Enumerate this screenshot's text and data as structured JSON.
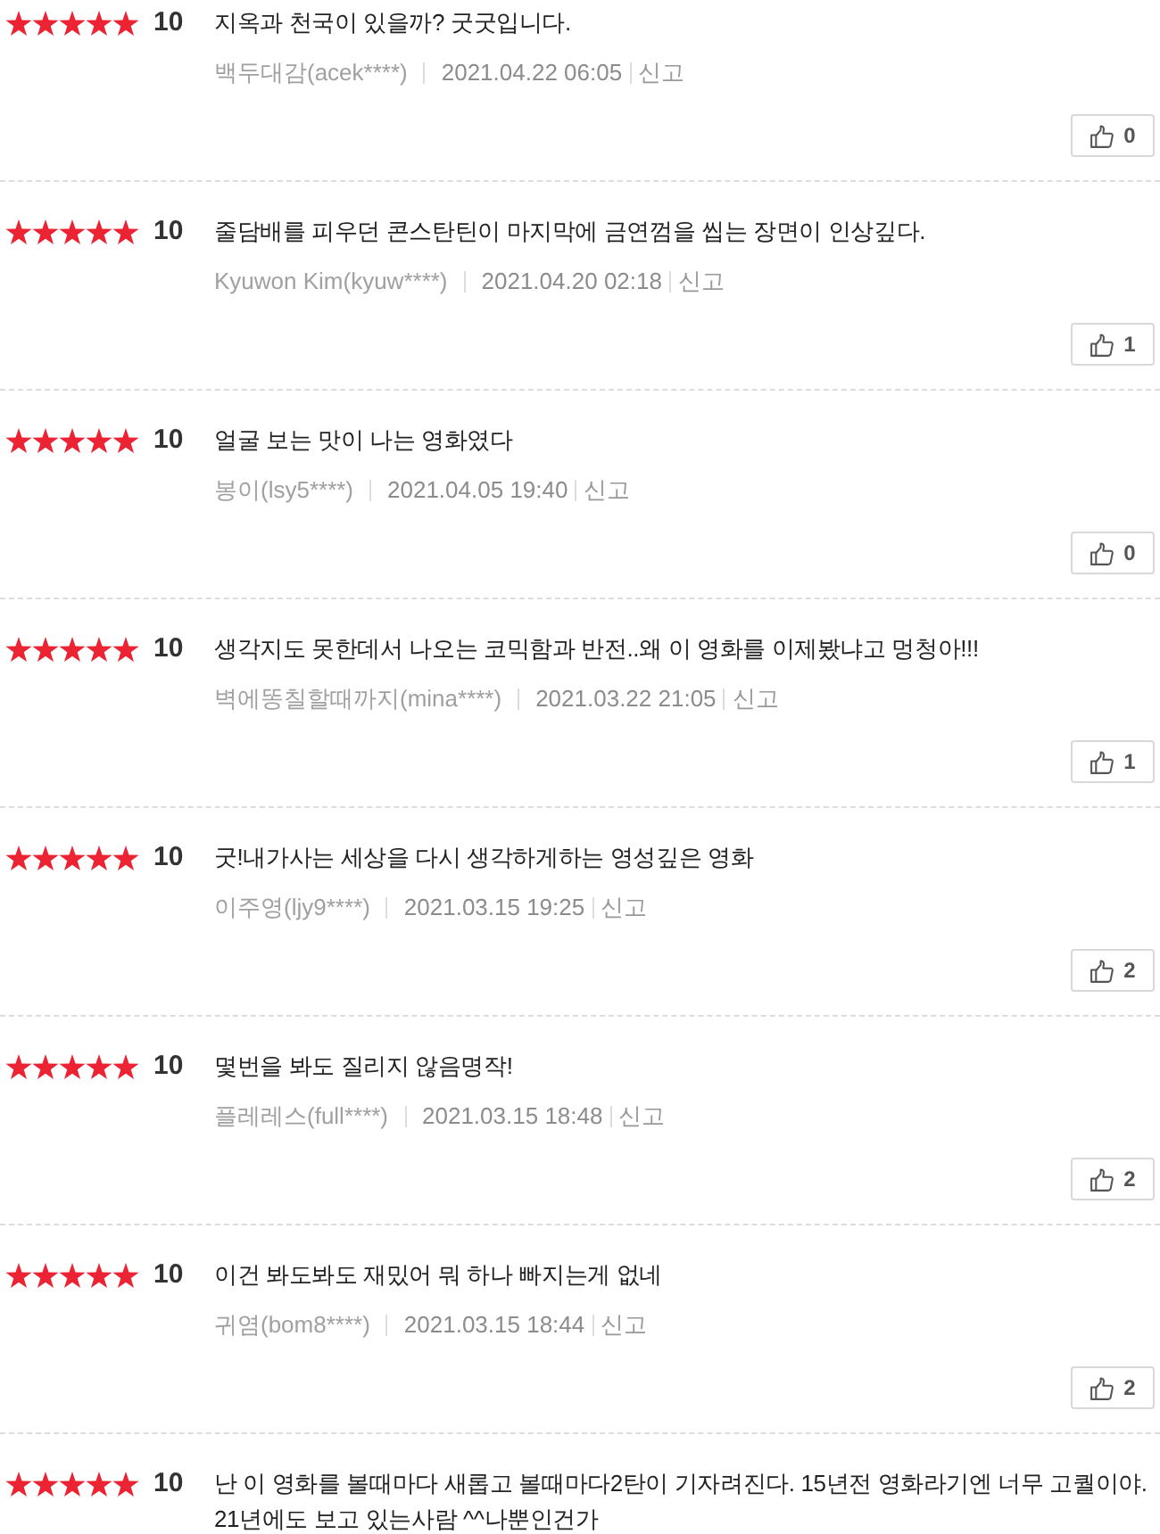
{
  "reviews": [
    {
      "stars": 5,
      "score": "10",
      "comment": "지옥과 천국이 있을까? 굿굿입니다.",
      "author": "백두대감(acek****)",
      "date": "2021.04.22 06:05",
      "report": "신고",
      "likes": "0"
    },
    {
      "stars": 5,
      "score": "10",
      "comment": "줄담배를 피우던 콘스탄틴이 마지막에 금연껌을 씹는 장면이 인상깊다.",
      "author": "Kyuwon Kim(kyuw****)",
      "date": "2021.04.20 02:18",
      "report": "신고",
      "likes": "1"
    },
    {
      "stars": 5,
      "score": "10",
      "comment": "얼굴 보는 맛이 나는 영화였다",
      "author": "봉이(lsy5****)",
      "date": "2021.04.05 19:40",
      "report": "신고",
      "likes": "0"
    },
    {
      "stars": 5,
      "score": "10",
      "comment": "생각지도 못한데서 나오는 코믹함과 반전..왜 이 영화를 이제봤냐고 멍청아!!!",
      "author": "벽에똥칠할때까지(mina****)",
      "date": "2021.03.22 21:05",
      "report": "신고",
      "likes": "1"
    },
    {
      "stars": 5,
      "score": "10",
      "comment": "굿!내가사는 세상을 다시 생각하게하는 영성깊은 영화",
      "author": "이주영(ljy9****)",
      "date": "2021.03.15 19:25",
      "report": "신고",
      "likes": "2"
    },
    {
      "stars": 5,
      "score": "10",
      "comment": "몇번을 봐도 질리지 않음명작!",
      "author": "플레레스(full****)",
      "date": "2021.03.15 18:48",
      "report": "신고",
      "likes": "2"
    },
    {
      "stars": 5,
      "score": "10",
      "comment": "이건 봐도봐도 재밌어 뭐 하나 빠지는게 없네",
      "author": "귀염(bom8****)",
      "date": "2021.03.15 18:44",
      "report": "신고",
      "likes": "2"
    },
    {
      "stars": 5,
      "score": "10",
      "comment": "난 이 영화를 볼때마다 새롭고 볼때마다2탄이 기자려진다. 15년전 영화라기엔 너무 고퀄이야. 21년에도 보고 있는사람 ^^나뿐인건가"
    }
  ]
}
